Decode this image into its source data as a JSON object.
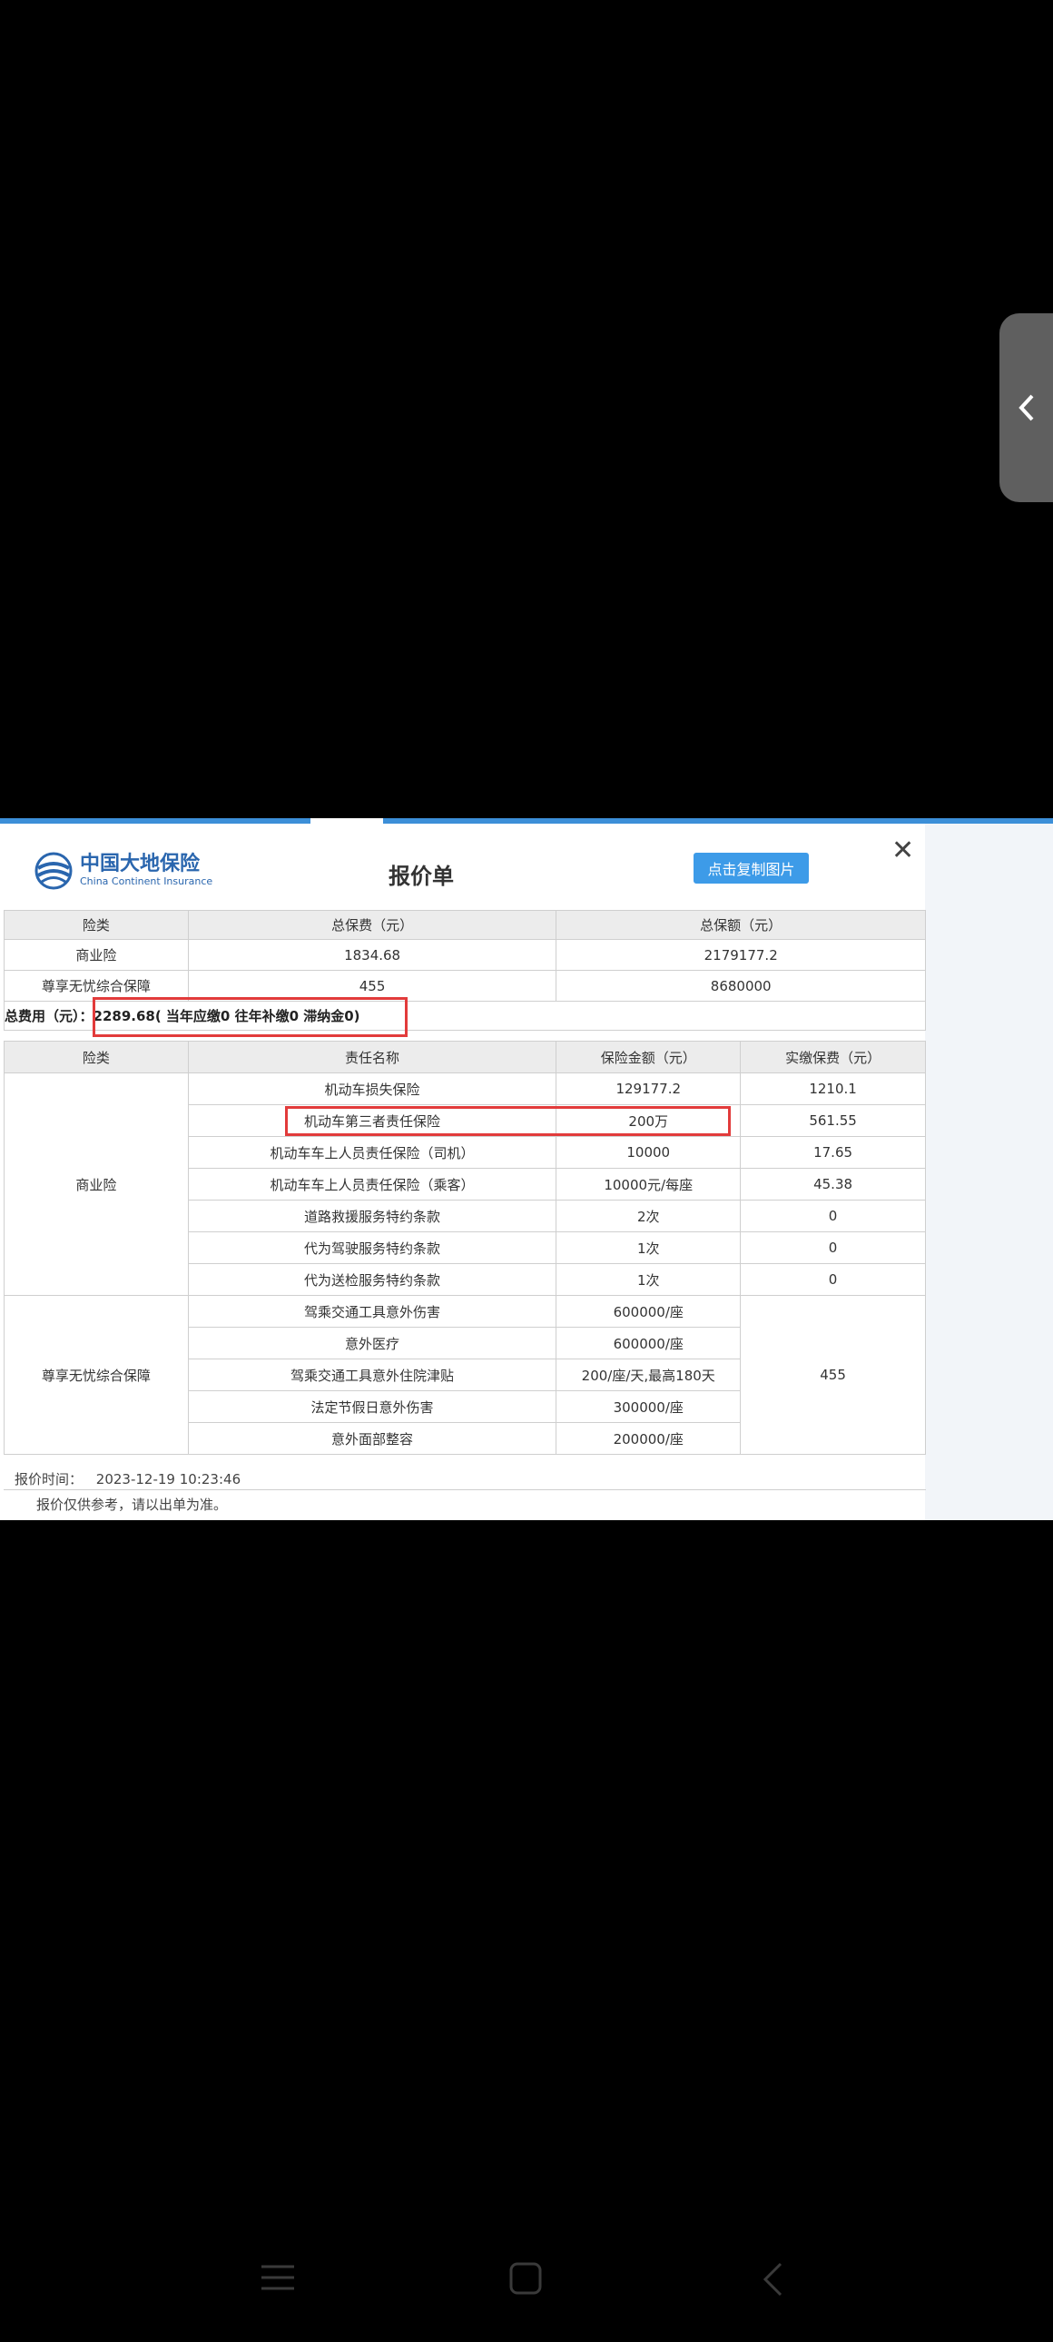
{
  "panel": {
    "logo": {
      "name": "中国大地保险",
      "name_en": "China Continent Insurance"
    },
    "title": "报价单",
    "copy_button": "点击复制图片",
    "close_icon": "close-icon"
  },
  "summary_table": {
    "headers": [
      "险类",
      "总保费（元）",
      "总保额（元）"
    ],
    "rows": [
      [
        "商业险",
        "1834.68",
        "2179177.2"
      ],
      [
        "尊享无忧综合保障",
        "455",
        "8680000"
      ]
    ]
  },
  "total": {
    "label": "总费用（元）：",
    "value": "2289.68",
    "detail": "( 当年应缴0 往年补缴0 滞纳金0)"
  },
  "detail_table": {
    "headers": [
      "险类",
      "责任名称",
      "保险金额（元）",
      "实缴保费（元）"
    ],
    "groups": [
      {
        "category": "商业险",
        "items": [
          {
            "name": "机动车损失保险",
            "amount": "129177.2",
            "premium": "1210.1"
          },
          {
            "name": "机动车第三者责任保险",
            "amount": "200万",
            "premium": "561.55"
          },
          {
            "name": "机动车车上人员责任保险（司机）",
            "amount": "10000",
            "premium": "17.65"
          },
          {
            "name": "机动车车上人员责任保险（乘客）",
            "amount": "10000元/每座",
            "premium": "45.38"
          },
          {
            "name": "道路救援服务特约条款",
            "amount": "2次",
            "premium": "0"
          },
          {
            "name": "代为驾驶服务特约条款",
            "amount": "1次",
            "premium": "0"
          },
          {
            "name": "代为送检服务特约条款",
            "amount": "1次",
            "premium": "0"
          }
        ]
      },
      {
        "category": "尊享无忧综合保障",
        "premium": "455",
        "items": [
          {
            "name": "驾乘交通工具意外伤害",
            "amount": "600000/座"
          },
          {
            "name": "意外医疗",
            "amount": "600000/座"
          },
          {
            "name": "驾乘交通工具意外住院津贴",
            "amount": "200/座/天,最高180天"
          },
          {
            "name": "法定节假日意外伤害",
            "amount": "300000/座"
          },
          {
            "name": "意外面部整容",
            "amount": "200000/座"
          }
        ]
      }
    ]
  },
  "footer": {
    "time_label": "报价时间：",
    "time_value": "2023-12-19 10:23:46",
    "note": "报价仅供参考，请以出单为准。"
  },
  "colors": {
    "accent": "#3d9be8",
    "highlight": "#e23b3b",
    "brand": "#2a66ae"
  },
  "nav": {
    "icons": [
      "menu-icon",
      "home-icon",
      "back-icon"
    ]
  }
}
